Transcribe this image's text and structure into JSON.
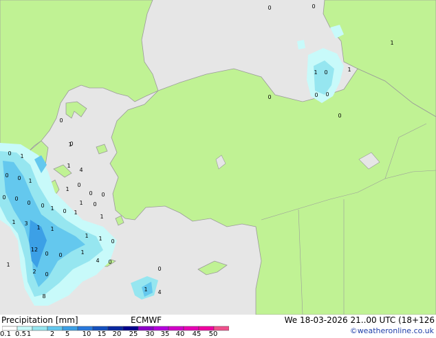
{
  "legend": {
    "title": "Precipitation [mm]",
    "model": "ECMWF",
    "datetime": "We 18-03-2026 21..00 UTC (18+126",
    "credit": "©weatheronline.co.uk",
    "colors": [
      "#ffffff",
      "#c8fafa",
      "#96e6f0",
      "#64c8ee",
      "#3ca0e6",
      "#2878dc",
      "#1450be",
      "#0a28a0",
      "#00008c",
      "#8c00c8",
      "#b400dc",
      "#d200c8",
      "#e600b4",
      "#f000a0",
      "#f0508c"
    ],
    "ticks": [
      "0.1",
      "0.5",
      "1",
      "2",
      "5",
      "10",
      "15",
      "20",
      "25",
      "30",
      "35",
      "40",
      "45",
      "50"
    ]
  },
  "map": {
    "land_color": "#c0f294",
    "sea_color": "#e6e6e6",
    "values": [
      "0",
      "0",
      "1",
      "1",
      "1",
      "0",
      "0",
      "0",
      "0",
      "0",
      "0",
      "1",
      "0",
      "1",
      "1",
      "1",
      "4",
      "0",
      "0",
      "1",
      "0",
      "0",
      "0",
      "0",
      "0",
      "0",
      "0",
      "1",
      "0",
      "1",
      "1",
      "1",
      "3",
      "1",
      "1",
      "1",
      "1",
      "0",
      "12",
      "0",
      "0",
      "4",
      "0",
      "1",
      "1",
      "2",
      "0",
      "0",
      "8",
      "1",
      "4",
      "0",
      "1",
      "0"
    ]
  }
}
